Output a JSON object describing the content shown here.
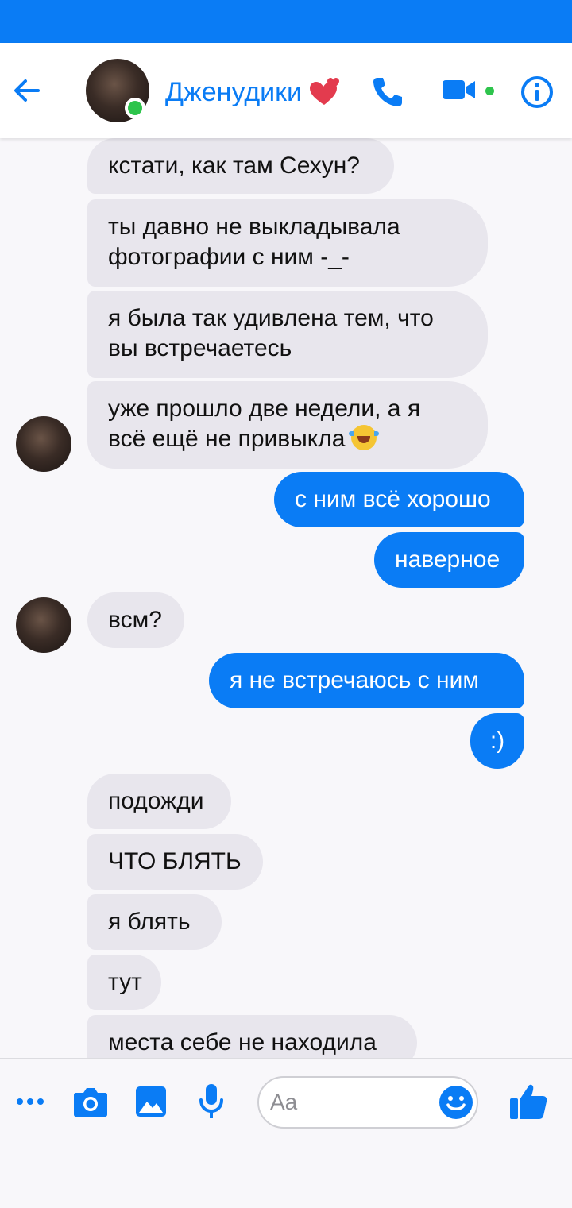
{
  "status_bar": {},
  "header": {
    "contact_name": "Дженудики",
    "heart_emoji": "two-hearts",
    "icons": [
      "back-arrow-icon",
      "phone-icon",
      "video-camera-icon",
      "info-icon"
    ],
    "accent_color": "#0a7cf5",
    "online_color": "#2ec44c"
  },
  "messages": [
    {
      "from": "them",
      "text": "кстати, как там Сехун?"
    },
    {
      "from": "them",
      "line1": "ты давно не выкладывала",
      "line2": "фотографии с ним -_-"
    },
    {
      "from": "them",
      "line1": "я была так удивлена тем, что",
      "line2": "вы встречаетесь"
    },
    {
      "from": "them",
      "line1": "уже прошло две недели, а я",
      "line2": "всё ещё не привыкла",
      "emoji": "rolling-on-floor-laughing"
    },
    {
      "from": "me",
      "text": "с ним всё хорошо"
    },
    {
      "from": "me",
      "text": "наверное"
    },
    {
      "from": "them",
      "text": "всм?"
    },
    {
      "from": "me",
      "text": "я не встречаюсь с ним"
    },
    {
      "from": "me",
      "text": ":)"
    },
    {
      "from": "them",
      "text": "подожди"
    },
    {
      "from": "them",
      "text": "ЧТО БЛЯТЬ"
    },
    {
      "from": "them",
      "text": "я блять"
    },
    {
      "from": "them",
      "text": "тут"
    },
    {
      "from": "them",
      "text": "места себе не находила"
    }
  ],
  "composer": {
    "placeholder": "Aa",
    "icons": [
      "more-icon",
      "camera-icon",
      "gallery-icon",
      "microphone-icon",
      "emoji-icon",
      "thumbs-up-icon"
    ]
  },
  "colors": {
    "incoming_bubble": "#e8e6ed",
    "outgoing_bubble": "#0a7cf5",
    "background": "#f8f7fa"
  }
}
